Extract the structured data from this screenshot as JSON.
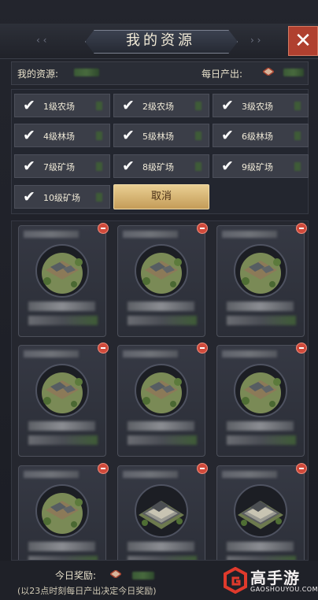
{
  "title": "我的资源",
  "info": {
    "my_resources_label": "我的资源:",
    "daily_output_label": "每日产出:"
  },
  "filters": [
    {
      "label": "1级农场",
      "checked": true
    },
    {
      "label": "2级农场",
      "checked": true
    },
    {
      "label": "3级农场",
      "checked": true
    },
    {
      "label": "4级林场",
      "checked": true
    },
    {
      "label": "5级林场",
      "checked": true
    },
    {
      "label": "6级林场",
      "checked": true
    },
    {
      "label": "7级矿场",
      "checked": true
    },
    {
      "label": "8级矿场",
      "checked": true
    },
    {
      "label": "9级矿场",
      "checked": true
    },
    {
      "label": "10级矿场",
      "checked": true
    }
  ],
  "cancel_label": "取消",
  "footer": {
    "today_reward_label": "今日奖励:",
    "note": "(以23点时刻每日产出决定今日奖励)"
  },
  "watermark": {
    "brand": "高手游",
    "site": "GAOSHOUYOU.COM"
  },
  "colors": {
    "accent_gold": "#c49c58",
    "close_red": "#b0402f",
    "remove_red": "#d04a3b"
  },
  "icons": {
    "close": "close-icon",
    "check": "check-icon",
    "remove": "remove-icon",
    "resource": "diamond-icon"
  }
}
